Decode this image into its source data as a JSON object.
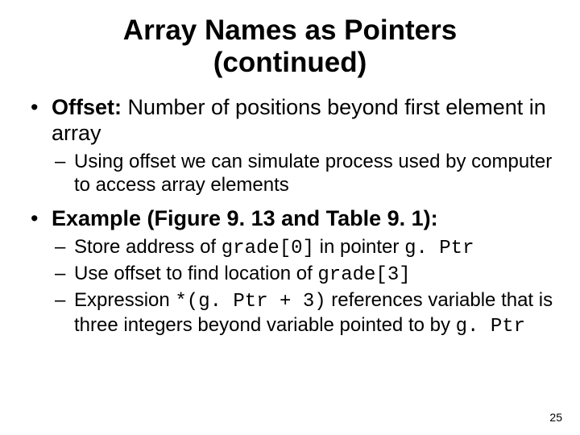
{
  "title_line1": "Array Names as Pointers",
  "title_line2": "(continued)",
  "b1_label": "Offset:",
  "b1_rest": "  Number of positions beyond first element in array",
  "b1_sub1": "Using offset we can simulate process used by computer to access array elements",
  "b2_label": "Example (Figure 9. 13 and Table 9. 1):",
  "b2s1_a": "Store address of ",
  "b2s1_code1": "grade[0]",
  "b2s1_b": " in pointer ",
  "b2s1_code2": "g. Ptr",
  "b2s2_a": "Use offset to find location of ",
  "b2s2_code1": "grade[3]",
  "b2s3_a": "Expression ",
  "b2s3_code1": "*(g. Ptr + 3)",
  "b2s3_b": " references variable that is three integers beyond variable pointed to by ",
  "b2s3_code2": "g. Ptr",
  "page_number": "25"
}
